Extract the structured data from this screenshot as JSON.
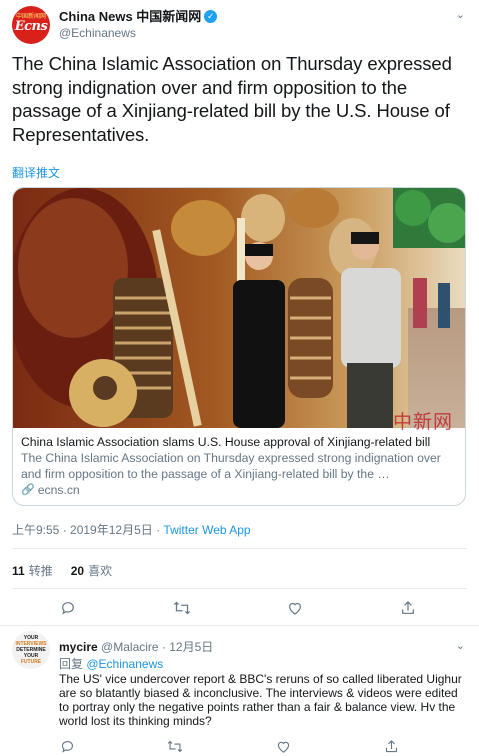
{
  "tweet": {
    "author": {
      "display_name": "China News 中国新闻网",
      "handle": "@Echinanews",
      "avatar_text_cn": "中国新闻网",
      "avatar_text_en": "Ecns",
      "verified_icon": "verified-badge-icon"
    },
    "text": "The China Islamic Association on Thursday expressed strong indignation over and firm opposition to the passage of a Xinjiang-related bill by the U.S. House of Representatives.",
    "translate_label": "翻译推文",
    "card": {
      "title": "China Islamic Association slams U.S. House approval of Xinjiang-related bill",
      "description": "The China Islamic Association on Thursday expressed strong indignation over and firm opposition to the passage of a Xinjiang-related bill by the …",
      "domain": "ecns.cn",
      "watermark": "中新网"
    },
    "meta": {
      "time_date": "上午9:55 · 2019年12月5日 · ",
      "source": "Twitter Web App"
    },
    "stats": {
      "retweets_count": "11",
      "retweets_label": "转推",
      "likes_count": "20",
      "likes_label": "喜欢"
    }
  },
  "reply": {
    "display_name": "mycire",
    "handle": "@Malacire",
    "date": "· 12月5日",
    "reply_to_label": "回复",
    "reply_to_handle": "@Echinanews",
    "avatar_lines": [
      "YOUR",
      "INTERVIEWS",
      "DETERMINE YOUR",
      "FUTURE"
    ],
    "text": "The US' vice undercover report & BBC's reruns of so called liberated Uighur are so blatantly biased & inconclusive. The interviews & videos were edited to portray only the negative points rather than a fair & balance view. Hv the world lost its thinking minds?"
  },
  "colors": {
    "accent": "#1b95e0",
    "text_primary": "#14171a",
    "text_secondary": "#657786",
    "border": "#e6ecf0",
    "avatar_red": "#d9201b"
  }
}
